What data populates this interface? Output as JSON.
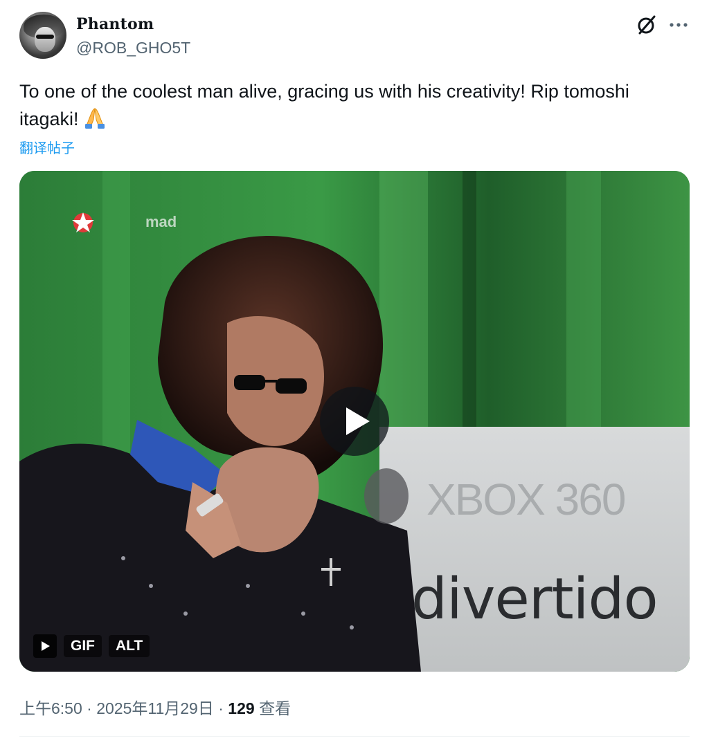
{
  "post": {
    "author": {
      "display_name": "Phantom",
      "handle": "@ROB_GHO5T",
      "avatar": "avatar-image"
    },
    "header_icons": [
      "grok-icon",
      "more-icon"
    ],
    "text": "To one of the coolest man alive, gracing us with his creativity! Rip tomoshi itagaki!",
    "emoji": "folded-hands-emoji",
    "translate_label": "翻译帖子",
    "media": {
      "type": "gif",
      "gif_label": "GIF",
      "alt_label": "ALT",
      "overlay_text_logo": "mad",
      "overlay_text_xbox": "XBOX 360",
      "overlay_text_sign": "divertido",
      "colors": {
        "background_green": "#2f8a3c",
        "sign_gray": "#c9cbcc"
      }
    },
    "meta": {
      "time": "上午6:50",
      "separator": "·",
      "date": "2025年11月29日",
      "views_count": "129",
      "views_label": "查看"
    }
  }
}
